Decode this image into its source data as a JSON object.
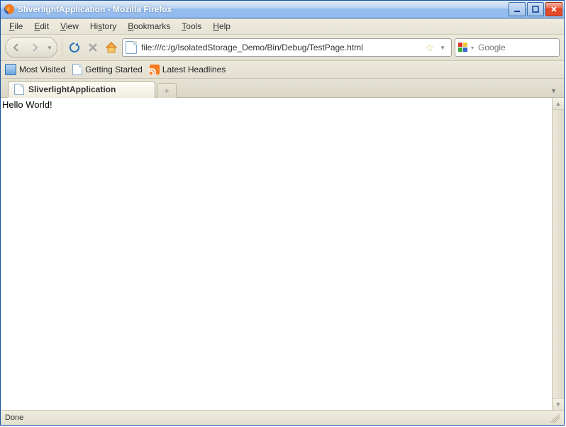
{
  "window": {
    "title": "SliverlightApplication - Mozilla Firefox"
  },
  "menu": {
    "file": "File",
    "edit": "Edit",
    "view": "View",
    "history": "History",
    "bookmarks": "Bookmarks",
    "tools": "Tools",
    "help": "Help"
  },
  "nav": {
    "url": "file:///c:/g/IsolatedStorage_Demo/Bin/Debug/TestPage.html",
    "search_placeholder": "Google"
  },
  "bookmarks_bar": {
    "most_visited": "Most Visited",
    "getting_started": "Getting Started",
    "latest_headlines": "Latest Headlines"
  },
  "tabs": {
    "active": "SliverlightApplication"
  },
  "page": {
    "body_text": "Hello World!"
  },
  "status": {
    "text": "Done"
  }
}
